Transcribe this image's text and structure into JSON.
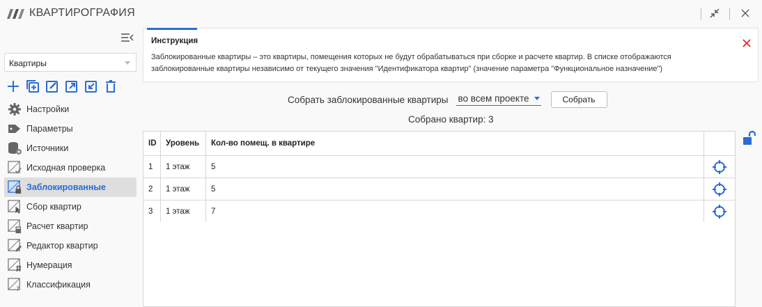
{
  "app": {
    "title": "КВАРТИРОГРАФИЯ"
  },
  "sidebar": {
    "dropdown_value": "Квартиры",
    "items": [
      {
        "label": "Настройки",
        "icon": "gear-icon"
      },
      {
        "label": "Параметры",
        "icon": "tag-icon"
      },
      {
        "label": "Источники",
        "icon": "database-icon"
      },
      {
        "label": "Исходная проверка",
        "icon": "check-doc-icon"
      },
      {
        "label": "Заблокированные",
        "icon": "locked-doc-icon",
        "active": true
      },
      {
        "label": "Сбор квартир",
        "icon": "collect-doc-icon"
      },
      {
        "label": "Расчет квартир",
        "icon": "calc-doc-icon"
      },
      {
        "label": "Редактор квартир",
        "icon": "edit-doc-icon"
      },
      {
        "label": "Нумерация",
        "icon": "hash-doc-icon"
      },
      {
        "label": "Классификация",
        "icon": "question-doc-icon"
      }
    ]
  },
  "instruction": {
    "heading": "Инструкция",
    "text": "Заблокированные квартиры – это квартиры, помещения которых не будут обрабатываться при сборке и расчете квартир. В списке отображаются заблокированные квартиры независимо от текущего значения \"Идентификатора квартир\" (значение параметра \"Функциональное назначение\")"
  },
  "collect": {
    "label": "Собрать заблокированные квартиры",
    "scope": "во всем проекте",
    "button": "Собрать",
    "count_text": "Собрано квартир: 3"
  },
  "table": {
    "headers": {
      "id": "ID",
      "level": "Уровень",
      "count": "Кол-во помещ. в квартире"
    },
    "rows": [
      {
        "id": "1",
        "level": "1 этаж",
        "count": "5"
      },
      {
        "id": "2",
        "level": "1 этаж",
        "count": "5"
      },
      {
        "id": "3",
        "level": "1 этаж",
        "count": "7"
      }
    ]
  },
  "colors": {
    "accent": "#2a6cd4",
    "close": "#e02424"
  }
}
